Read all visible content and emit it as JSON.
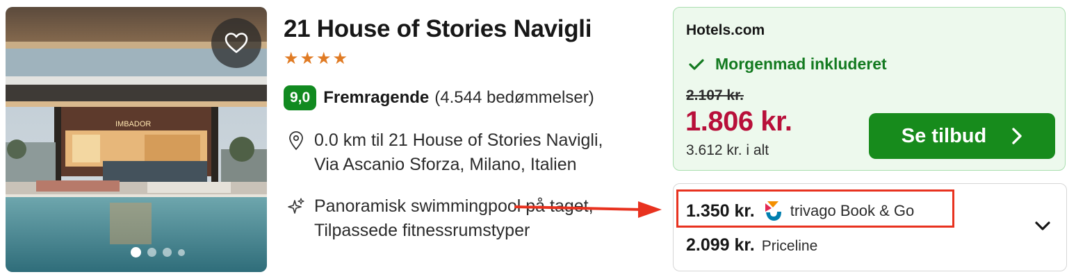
{
  "hotel": {
    "name": "21 House of Stories Navigli",
    "stars": 4,
    "star_glyph": "★",
    "score": "9,0",
    "rating_label": "Fremragende",
    "reviews": "(4.544 bedømmelser)",
    "location": [
      "0.0 km til 21 House of Stories Navigli,",
      "Via Ascanio Sforza, Milano, Italien"
    ],
    "amenities": [
      "Panoramisk swimmingpool på taget,",
      "Tilpassede fitnessrumstyper"
    ],
    "photo": {
      "slides": 4,
      "active_slide": 1
    }
  },
  "deal": {
    "provider": "Hotels.com",
    "breakfast": "Morgenmad inkluderet",
    "old_price": "2.107 kr.",
    "price": "1.806 kr.",
    "total": "3.612 kr. i alt",
    "cta": "Se tilbud"
  },
  "offers": [
    {
      "price": "1.350 kr.",
      "provider": "trivago Book & Go",
      "highlighted": true
    },
    {
      "price": "2.099 kr.",
      "provider": "Priceline",
      "highlighted": false
    }
  ],
  "colors": {
    "score_bg": "#118a20",
    "star": "#e07b24",
    "deal_bg": "#edf9ed",
    "deal_border": "#a9deaf",
    "price_red": "#b8103a",
    "cta_green": "#178b1c",
    "breakfast_green": "#137a20",
    "highlight_red": "#e8321f"
  },
  "icons": {
    "favorite": "heart-icon",
    "location": "map-pin-icon",
    "amenity": "sparkle-icon",
    "breakfast": "checkmark-icon",
    "cta": "chevron-right-icon",
    "expand": "chevron-down-icon",
    "provider_logo": "trivago-logo-icon",
    "annotation": "red-arrow-icon"
  }
}
